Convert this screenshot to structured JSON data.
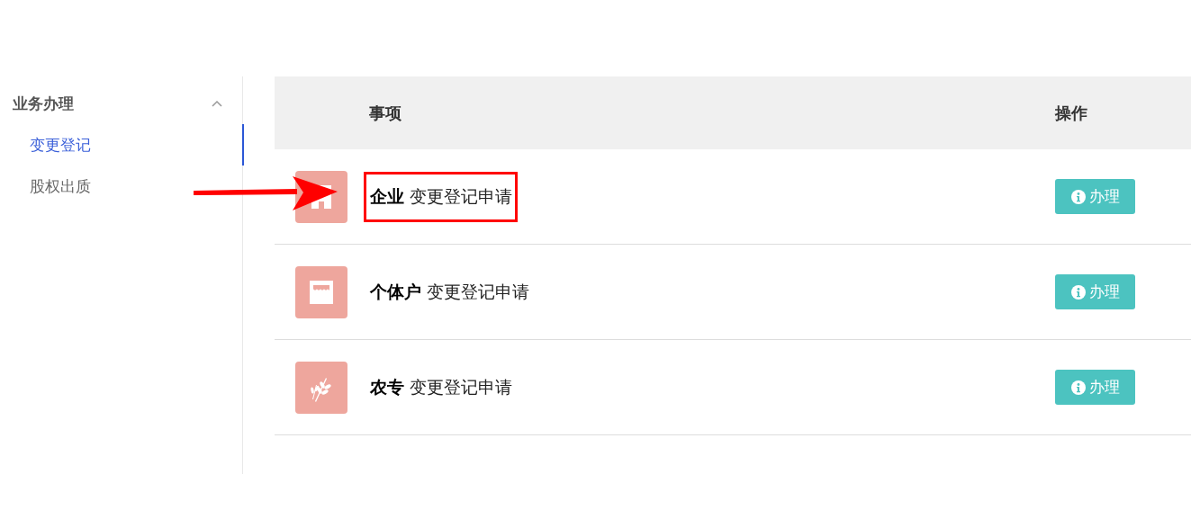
{
  "sidebar": {
    "group": {
      "label": "业务办理",
      "expanded": true
    },
    "items": [
      {
        "label": "变更登记",
        "selected": true
      },
      {
        "label": "股权出质",
        "selected": false
      }
    ]
  },
  "table": {
    "columns": [
      "事项",
      "操作"
    ],
    "rows": [
      {
        "kind": "building",
        "title": "**企业** 变更登记申请",
        "highlighted": true,
        "action": "办理"
      },
      {
        "kind": "shop",
        "title": "**个体户** 变更登记申请",
        "highlighted": false,
        "action": "办理"
      },
      {
        "kind": "wheat",
        "title": "**农专** 变更登记申请",
        "highlighted": false,
        "action": "办理"
      }
    ]
  },
  "annotation": {
    "arrow": true
  }
}
